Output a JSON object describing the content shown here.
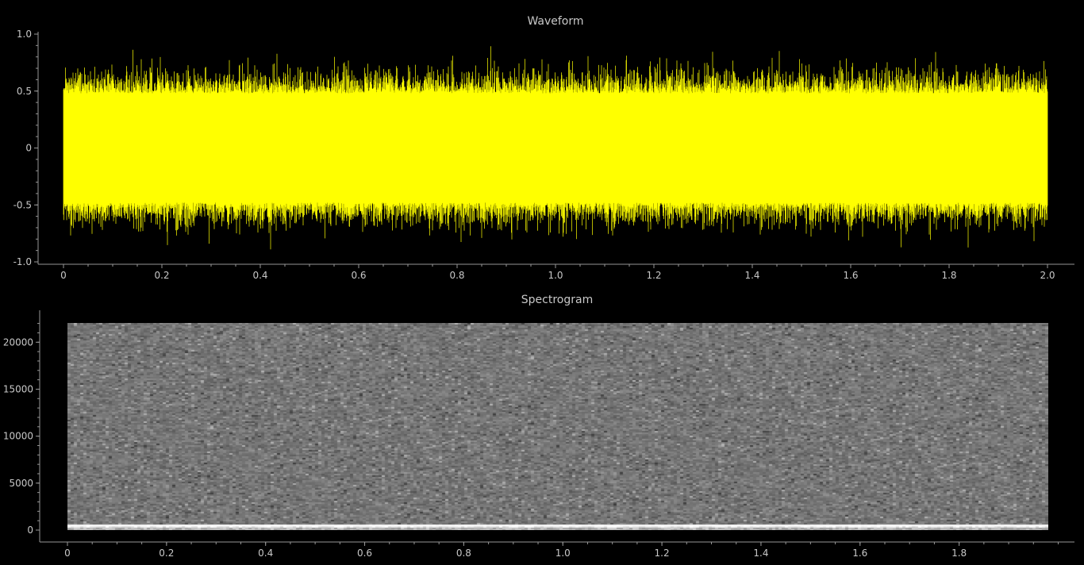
{
  "theme": {
    "background": "#000000",
    "axis_color": "#969696",
    "text_color": "#c8c8c8",
    "title_color": "#c8c8c8",
    "waveform_color": "#ffff00",
    "spectrogram_low": "#303030",
    "spectrogram_high": "#b8b8b8",
    "spectrogram_band": "#ffffff"
  },
  "chart_data": [
    {
      "type": "line",
      "title": "Waveform",
      "xlabel": "",
      "ylabel": "",
      "xlim": [
        0,
        2.0
      ],
      "ylim": [
        -1.0,
        1.0
      ],
      "x_ticks": [
        0,
        0.2,
        0.4,
        0.6,
        0.8,
        1.0,
        1.2,
        1.4,
        1.6,
        1.8,
        2.0
      ],
      "x_tick_labels": [
        "0",
        "0.2",
        "0.4",
        "0.6",
        "0.8",
        "1.0",
        "1.2",
        "1.4",
        "1.6",
        "1.8",
        "2.0"
      ],
      "y_ticks": [
        1.0,
        0.5,
        0,
        -0.5,
        -1.0
      ],
      "y_tick_labels": [
        "1.0",
        "0.5",
        "0",
        "-0.5",
        "-1.0"
      ],
      "series": [
        {
          "signal": "noise",
          "x_range": [
            0,
            2.0
          ],
          "body_amplitude": [
            -0.5,
            0.5
          ],
          "peak_amplitude": [
            -0.89,
            0.9
          ],
          "color": "#ffff00"
        }
      ],
      "grid": false
    },
    {
      "type": "heatmap",
      "title": "Spectrogram",
      "xlabel": "",
      "ylabel": "",
      "xlim": [
        0,
        2.0
      ],
      "ylim": [
        0,
        22050
      ],
      "x_ticks": [
        0,
        0.2,
        0.4,
        0.6,
        0.8,
        1.0,
        1.2,
        1.4,
        1.6,
        1.8
      ],
      "x_tick_labels": [
        "0",
        "0.2",
        "0.4",
        "0.6",
        "0.8",
        "1.0",
        "1.2",
        "1.4",
        "1.6",
        "1.8"
      ],
      "y_ticks": [
        20000,
        15000,
        10000,
        5000,
        0
      ],
      "y_tick_labels": [
        "20000",
        "15000",
        "10000",
        "5000",
        "0"
      ],
      "time_range": [
        0,
        1.98
      ],
      "frequency_range": [
        0,
        22050
      ],
      "low_frequency_band": [
        0,
        700
      ],
      "colormap": "grayscale",
      "grid": false
    }
  ]
}
